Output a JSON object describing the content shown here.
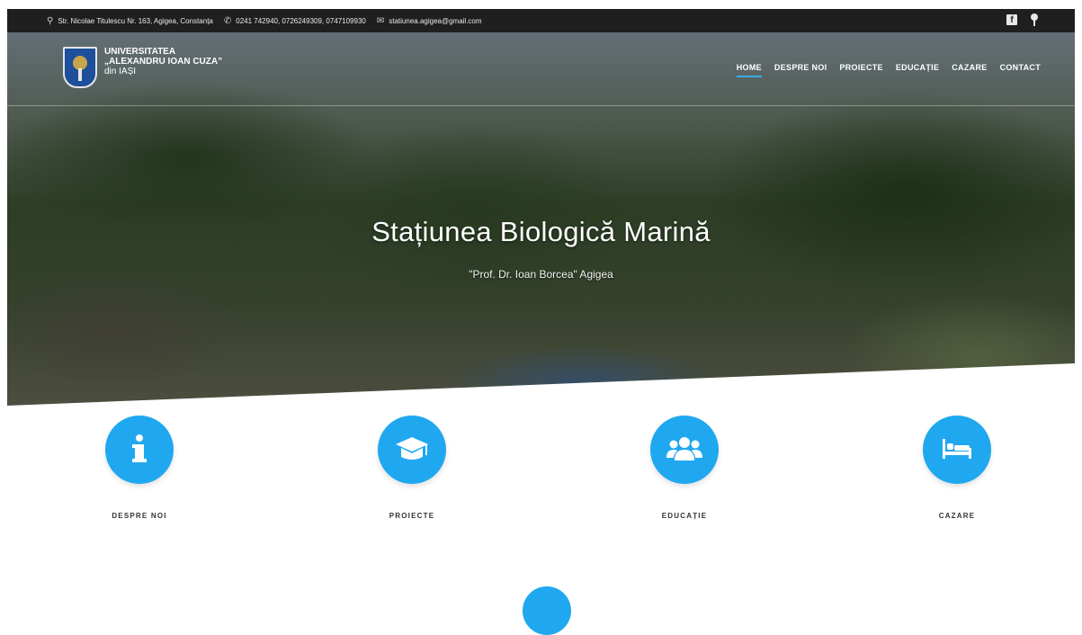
{
  "topbar": {
    "address": "Str. Nicolae Titulescu Nr. 163, Agigea, Constanța",
    "phone": "0241 742940, 0726249309, 0747109930",
    "email": "statiunea.agigea@gmail.com",
    "icons": {
      "address": "map-pin-icon",
      "phone": "phone-icon",
      "email": "envelope-icon",
      "social_1": "facebook-icon",
      "social_2": "location-pin-icon"
    }
  },
  "logo": {
    "line1": "UNIVERSITATEA",
    "line2": "„ALEXANDRU IOAN CUZA”",
    "line3": "din IAȘI"
  },
  "nav": {
    "items": [
      "HOME",
      "DESPRE NOI",
      "PROIECTE",
      "EDUCAȚIE",
      "CAZARE",
      "CONTACT"
    ],
    "active": "HOME"
  },
  "hero": {
    "title": "Stațiunea Biologică Marină",
    "subtitle": "\"Prof. Dr. Ioan Borcea\" Agigea"
  },
  "features": [
    {
      "label": "DESPRE NOI",
      "icon": "info-icon"
    },
    {
      "label": "PROIECTE",
      "icon": "graduation-cap-icon"
    },
    {
      "label": "EDUCAȚIE",
      "icon": "users-icon"
    },
    {
      "label": "CAZARE",
      "icon": "bed-icon"
    }
  ],
  "colors": {
    "accent": "#1fa8f0",
    "topbar": "#1f1f1f",
    "white": "#ffffff"
  }
}
